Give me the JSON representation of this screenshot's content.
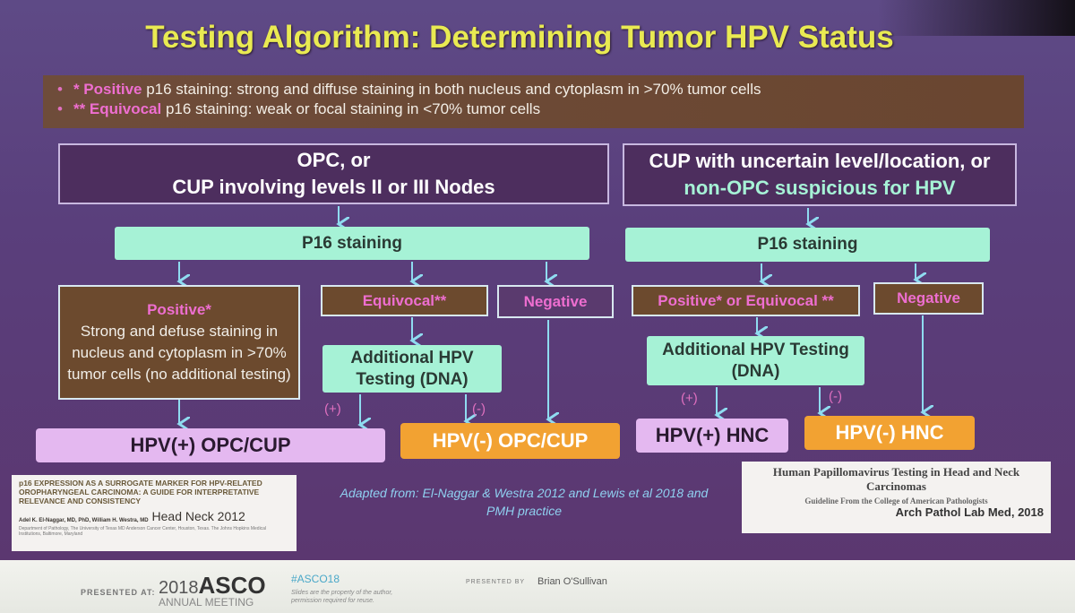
{
  "title": "Testing Algorithm: Determining Tumor HPV Status",
  "bullets": [
    {
      "marker": "•",
      "highlight": "* Positive",
      "text": " p16 staining: strong and diffuse staining in both nucleus and cytoplasm in >70% tumor cells"
    },
    {
      "marker": "•",
      "highlight": "** Equivocal",
      "text": " p16 staining: weak or focal staining in <70% tumor cells"
    }
  ],
  "left": {
    "header_line1": "OPC, or",
    "header_line2": "CUP involving levels II or III Nodes",
    "p16": "P16 staining",
    "positive_title": "Positive*",
    "positive_text": "Strong and defuse staining in nucleus and cytoplasm in >70% tumor cells (no additional testing)",
    "equivocal": "Equivocal**",
    "negative": "Negative",
    "additional_line1": "Additional HPV",
    "additional_line2": "Testing (DNA)",
    "plus_label": "(+)",
    "minus_label": "(-)",
    "hpv_pos": "HPV(+) OPC/CUP",
    "hpv_neg": "HPV(-) OPC/CUP"
  },
  "right": {
    "header_line1": "CUP with uncertain level/location, or",
    "header_line2": "non-OPC suspicious for HPV",
    "p16": "P16 staining",
    "pos_equiv": "Positive* or Equivocal **",
    "negative": "Negative",
    "additional_line1": "Additional HPV Testing",
    "additional_line2": "(DNA)",
    "plus_label": "(+)",
    "minus_label": "(-)",
    "hpv_pos": "HPV(+) HNC",
    "hpv_neg": "HPV(-) HNC"
  },
  "citation_left": {
    "title": "p16 EXPRESSION AS A SURROGATE MARKER FOR HPV-RELATED OROPHARYNGEAL CARCINOMA: A GUIDE FOR INTERPRETATIVE RELEVANCE AND CONSISTENCY",
    "authors": "Adel K. El-Naggar, MD, PhD, William H. Westra, MD",
    "journal": "Head Neck 2012",
    "affiliation": "Department of Pathology, The University of Texas MD Anderson Cancer Center, Houston, Texas. The Johns Hopkins Medical Institutions, Baltimore, Maryland"
  },
  "adapted": "Adapted from: El-Naggar & Westra 2012 and Lewis et al 2018 and PMH practice",
  "citation_right": {
    "title": "Human Papillomavirus Testing in Head and Neck Carcinomas",
    "subtitle": "Guideline From the College of American Pathologists",
    "journal": "Arch Pathol Lab Med, 2018"
  },
  "footer": {
    "presented_at": "PRESENTED AT:",
    "year": "2018",
    "asco": "ASCO",
    "meeting": "ANNUAL MEETING",
    "hashtag": "#ASCO18",
    "disclaimer_1": "Slides are the property of the author,",
    "disclaimer_2": "permission required for reuse.",
    "presented_by": "PRESENTED BY",
    "presenter": "Brian O'Sullivan"
  },
  "colors": {
    "title": "#e9ea52",
    "highlight": "#ee6ed0",
    "mint": "#a6f2d6",
    "brown": "#6c4a2e",
    "lilac": "#e4b8f0",
    "orange": "#f2a232",
    "arrow": "#8fdcf0"
  }
}
